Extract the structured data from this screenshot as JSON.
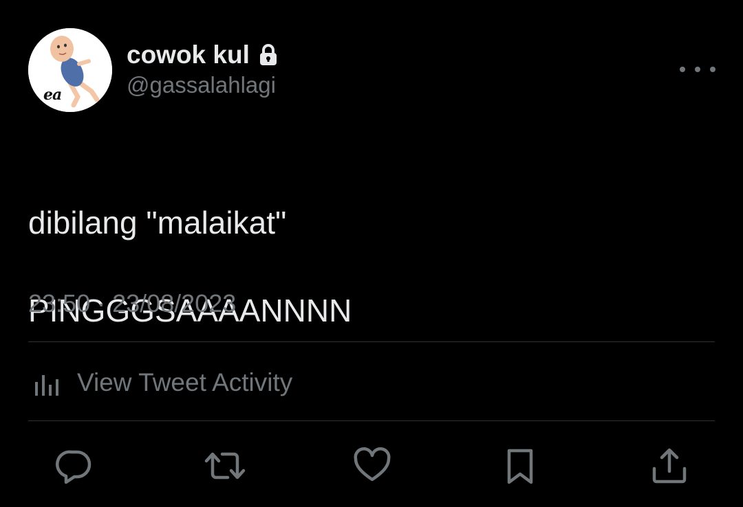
{
  "user": {
    "display_name": "cowok kul",
    "handle": "@gassalahlagi",
    "avatar_caption": "ea",
    "protected_icon": "lock-icon"
  },
  "tweet": {
    "lines": [
      "dibilang \"malaikat\"",
      "PINGGGSAAAANNNN"
    ],
    "timestamp": "23:50 · 23/08/2023"
  },
  "activity": {
    "label": "View Tweet Activity",
    "icon": "bar-chart-icon"
  },
  "actions": [
    {
      "name": "reply",
      "icon": "reply-bubble-icon"
    },
    {
      "name": "retweet",
      "icon": "retweet-icon"
    },
    {
      "name": "like",
      "icon": "heart-icon"
    },
    {
      "name": "bookmark",
      "icon": "bookmark-icon"
    },
    {
      "name": "share",
      "icon": "share-upload-icon"
    }
  ],
  "colors": {
    "background": "#000000",
    "primary_text": "#e7e9ea",
    "secondary_text": "#71767b",
    "divider": "#2f3336"
  }
}
